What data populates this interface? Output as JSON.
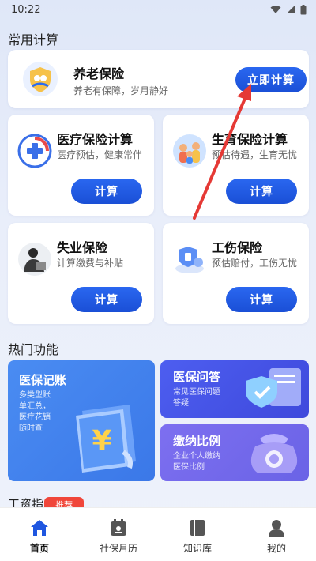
{
  "status_bar": {
    "time": "10:22"
  },
  "common_calc": {
    "section_title": "常用计算",
    "pension": {
      "title": "养老保险",
      "subtitle": "养老有保障，岁月静好",
      "button": "立即计算"
    },
    "cards": [
      {
        "title": "医疗保险计算",
        "subtitle": "医疗预估，健康常伴",
        "button": "计算",
        "icon": "medical-icon"
      },
      {
        "title": "生育保险计算",
        "subtitle": "预估待遇，生育无忧",
        "button": "计算",
        "icon": "maternity-icon"
      },
      {
        "title": "失业保险",
        "subtitle": "计算缴费与补贴",
        "button": "计算",
        "icon": "unemployment-icon"
      },
      {
        "title": "工伤保险",
        "subtitle": "预估赔付，工伤无忧",
        "button": "计算",
        "icon": "work-injury-icon"
      }
    ]
  },
  "hot_features": {
    "section_title": "热门功能",
    "ledger": {
      "title": "医保记账",
      "subtitle_lines": [
        "多类型账",
        "单汇总，",
        "医疗花销",
        "随时查"
      ]
    },
    "qa": {
      "title": "医保问答",
      "subtitle_lines": [
        "常见医保问题",
        "答疑"
      ]
    },
    "ratio": {
      "title": "缴纳比例",
      "subtitle_lines": [
        "企业个人缴纳",
        "医保比例"
      ]
    }
  },
  "next_section": {
    "title": "工资指",
    "badge": "推荐"
  },
  "tab_bar": {
    "tabs": [
      {
        "label": "首页",
        "icon": "home-icon",
        "active": true
      },
      {
        "label": "社保月历",
        "icon": "calendar-icon",
        "active": false
      },
      {
        "label": "知识库",
        "icon": "book-icon",
        "active": false
      },
      {
        "label": "我的",
        "icon": "profile-icon",
        "active": false
      }
    ]
  },
  "colors": {
    "primary": "#1f56e0",
    "accent_red": "#e53935",
    "badge": "#f0463a"
  }
}
